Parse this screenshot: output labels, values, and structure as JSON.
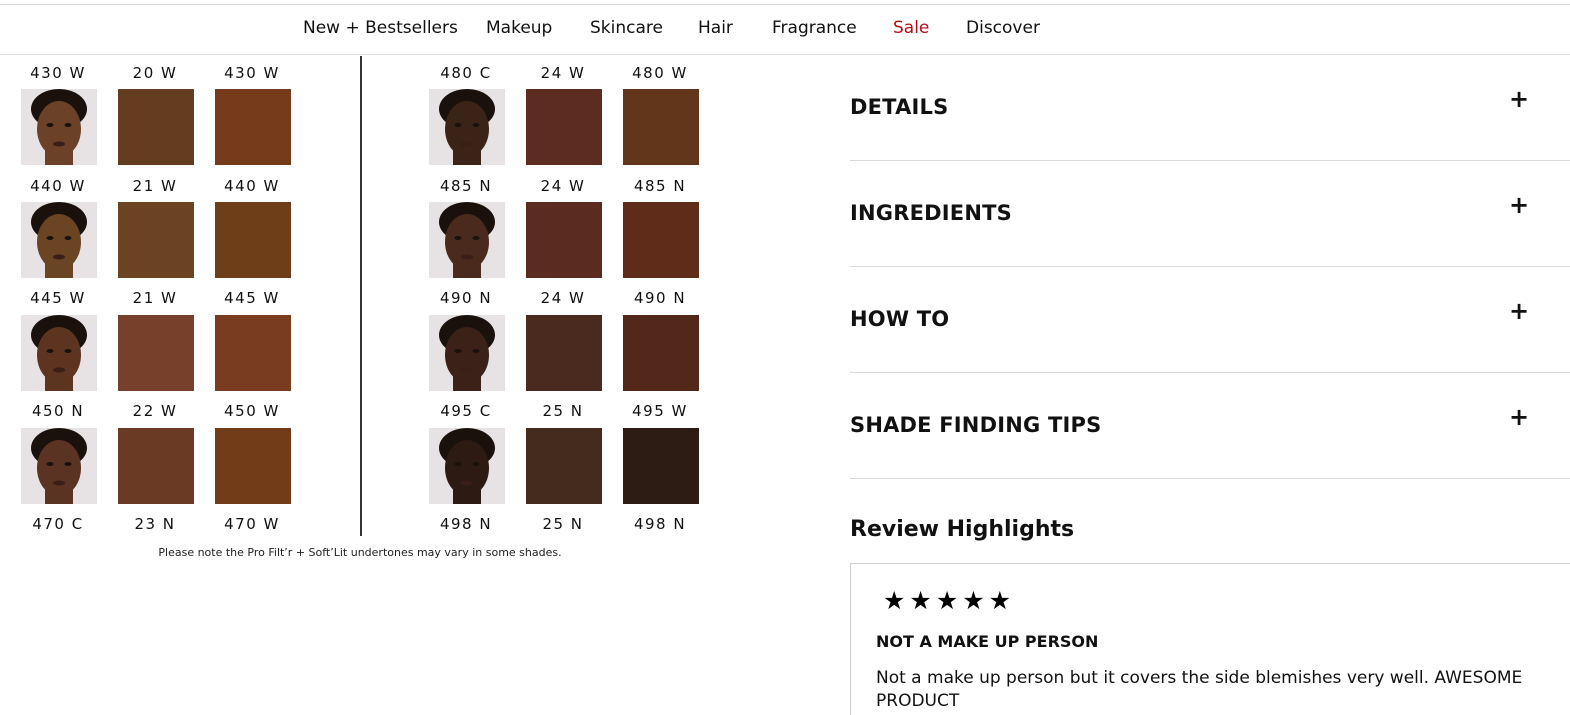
{
  "nav": {
    "items": [
      "New + Bestsellers",
      "Makeup",
      "Skincare",
      "Hair",
      "Fragrance",
      "Sale",
      "Discover"
    ]
  },
  "shade_chart": {
    "left": {
      "header": [
        "430 W",
        "20 W",
        "430 W"
      ],
      "rows": [
        {
          "swatch_colors": [
            "#643c1f",
            "#763b1a"
          ],
          "labels": [
            "440 W",
            "21 W",
            "440 W"
          ],
          "face_tone": "#6b4128"
        },
        {
          "swatch_colors": [
            "#6b4322",
            "#6e3e19"
          ],
          "labels": [
            "445 W",
            "21 W",
            "445 W"
          ],
          "face_tone": "#6a4423"
        },
        {
          "swatch_colors": [
            "#77402a",
            "#7a3c21"
          ],
          "labels": [
            "450 N",
            "22 W",
            "450 W"
          ],
          "face_tone": "#5c3420"
        },
        {
          "swatch_colors": [
            "#6a3a25",
            "#733c18"
          ],
          "labels": [
            "470 C",
            "23 N",
            "470 W"
          ],
          "face_tone": "#5a3322"
        }
      ]
    },
    "right": {
      "header": [
        "480 C",
        "24 W",
        "480 W"
      ],
      "rows": [
        {
          "swatch_colors": [
            "#5b2c1f",
            "#62361a"
          ],
          "labels": [
            "485 N",
            "24 W",
            "485 N"
          ],
          "face_tone": "#3c2318"
        },
        {
          "swatch_colors": [
            "#5a2c1f",
            "#5f2c1a"
          ],
          "labels": [
            "490 N",
            "24 W",
            "490 N"
          ],
          "face_tone": "#4a2a1c"
        },
        {
          "swatch_colors": [
            "#4a2a1f",
            "#512819"
          ],
          "labels": [
            "495 C",
            "25 N",
            "495 W"
          ],
          "face_tone": "#3b2118"
        },
        {
          "swatch_colors": [
            "#452a1e",
            "#2d1c13"
          ],
          "labels": [
            "498 N",
            "25 N",
            "498 N"
          ],
          "face_tone": "#2c1a13"
        }
      ]
    },
    "note": "Please note the Pro Filt’r + Soft’Lit undertones may vary in some shades."
  },
  "accordions": [
    {
      "title": "DETAILS",
      "icon": "plus-icon",
      "symbol": "+"
    },
    {
      "title": "INGREDIENTS",
      "icon": "plus-icon",
      "symbol": "+"
    },
    {
      "title": "HOW TO",
      "icon": "plus-icon",
      "symbol": "+"
    },
    {
      "title": "SHADE FINDING TIPS",
      "icon": "plus-icon",
      "symbol": "+"
    }
  ],
  "reviews": {
    "heading": "Review Highlights",
    "items": [
      {
        "rating": 5,
        "stars": "★★★★★",
        "title": "NOT A MAKE UP PERSON",
        "body": "Not a make up person but it covers the side blemishes very well. AWESOME PRODUCT"
      }
    ]
  },
  "colors": {
    "sale": "#b10d14",
    "divider": "#333333",
    "border": "#d9d9d9"
  }
}
